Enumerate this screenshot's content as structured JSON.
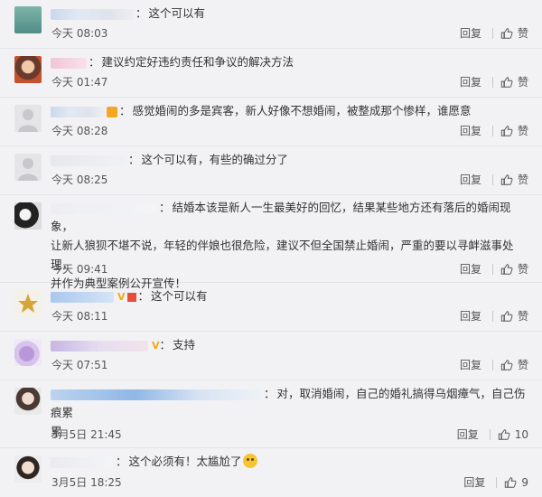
{
  "comments": [
    {
      "text": "这个可以有",
      "time": "今天 08:03",
      "reply": "回复",
      "like": "赞"
    },
    {
      "text": "建议约定好违约责任和争议的解决方法",
      "time": "今天 01:47",
      "reply": "回复",
      "like": "赞"
    },
    {
      "text": "感觉婚闹的多是宾客，新人好像不想婚闹，被整成那个惨样，谁愿意",
      "time": "今天 08:28",
      "reply": "回复",
      "like": "赞"
    },
    {
      "text": "这个可以有，有些的确过分了",
      "time": "今天 08:25",
      "reply": "回复",
      "like": "赞"
    },
    {
      "text_lines": [
        "结婚本该是新人一生最美好的回忆，结果某些地方还有落后的婚闹现象，",
        "让新人狼狈不堪不说，年轻的伴娘也很危险，建议不但全国禁止婚闹，严重的要以寻衅滋事处理，",
        "并作为典型案例公开宣传！"
      ],
      "time": "今天 09:41",
      "reply": "回复",
      "like": "赞"
    },
    {
      "text": "这个可以有",
      "time": "今天 08:11",
      "reply": "回复",
      "like": "赞"
    },
    {
      "text": "支持",
      "time": "今天 07:51",
      "reply": "回复",
      "like": "赞"
    },
    {
      "text_lines": [
        "对，取消婚闹，自己的婚礼搞得乌烟瘴气，自己伤痕累",
        "累"
      ],
      "time": "3月5日 21:45",
      "reply": "回复",
      "like": "10"
    },
    {
      "text": "这个必须有！太尴尬了",
      "time": "3月5日 18:25",
      "reply": "回复",
      "like": "9"
    }
  ],
  "colors": {
    "badge_v": "#f3a712",
    "text": "#333333",
    "meta": "#555555"
  },
  "icons": {
    "like": "thumbs-up-icon"
  }
}
